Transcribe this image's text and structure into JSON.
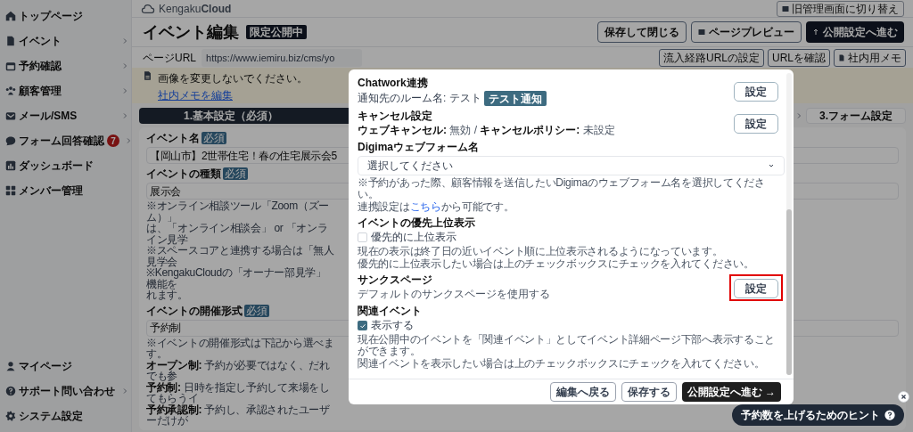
{
  "header": {
    "logo_text": "Kengaku",
    "logo_bold": "Cloud",
    "switch_button": "旧管理画面に切り替え"
  },
  "sidebar": {
    "items": [
      {
        "label": "トップページ",
        "expandable": false
      },
      {
        "label": "イベント",
        "expandable": true
      },
      {
        "label": "予約確認",
        "expandable": true
      },
      {
        "label": "顧客管理",
        "expandable": true
      },
      {
        "label": "メール/SMS",
        "expandable": true
      },
      {
        "label": "フォーム回答確認",
        "expandable": true,
        "badge": "7"
      },
      {
        "label": "ダッシュボード",
        "expandable": false
      },
      {
        "label": "メンバー管理",
        "expandable": false
      }
    ],
    "bottom_items": [
      {
        "label": "マイページ",
        "expandable": false
      },
      {
        "label": "サポート問い合わせ",
        "expandable": true
      },
      {
        "label": "システム設定",
        "expandable": false
      }
    ]
  },
  "page": {
    "title": "イベント編集",
    "status_badge": "限定公開中",
    "actions": [
      {
        "label": "保存して閉じる",
        "kind": "outline"
      },
      {
        "label": "ページプレビュー",
        "kind": "preview"
      },
      {
        "label": "公開設定へ進む",
        "kind": "primary"
      }
    ],
    "url": {
      "label": "ページURL",
      "value": "https://www.iemiru.biz/cms/yo"
    },
    "url_actions": [
      {
        "label": "流入経路URLの設定",
        "kind": "plain"
      },
      {
        "label": "URLを確認",
        "kind": "plain"
      },
      {
        "label": "社内用メモ",
        "kind": "memo"
      }
    ],
    "memo": {
      "text": "画像を変更しないでください。",
      "link": "社内メモを編集"
    },
    "steps": [
      {
        "label": "1.基本設定（必須）",
        "selected": true
      },
      {
        "label": "3.フォーム設定",
        "selected": false
      }
    ],
    "form": [
      {
        "label": "イベント名",
        "required": "必須",
        "value": "【岡山市】2世帯住宅！春の住宅展示会5"
      },
      {
        "label": "イベントの種類",
        "required": "必須",
        "value": "展示会",
        "notes": [
          "※オンライン相談ツール「Zoom（ズーム）」",
          "は、「オンライン相談会」 or 「オンライン見学",
          "※スペースコアと連携する場合は「無人見学会",
          "※KengakuCloudの「オーナー部見学」機能を",
          "れます。"
        ]
      },
      {
        "label": "イベントの開催形式",
        "required": "必須",
        "value": "予約制",
        "notes": [
          "※イベントの開催形式は下記から選べます。",
          "**オープン制:** 予約が必要ではなく、だれでも参",
          "**予約制:** 日時を指定し予約して来場をしてもらうイ",
          "**予約承認制:** 予約し、承認されたユーザーだけが"
        ]
      }
    ]
  },
  "modal": {
    "sections": [
      {
        "kind": "setting",
        "title": "Chatwork連携",
        "text": "通知先のルーム名: テスト",
        "tag": "テスト通知",
        "button": "設定",
        "highlighted": false
      },
      {
        "kind": "setting",
        "title": "キャンセル設定",
        "text": "**ウェブキャンセル:** 無効 / **キャンセルポリシー:** 未設定",
        "button": "設定",
        "highlighted": false
      },
      {
        "kind": "select",
        "title": "Digimaウェブフォーム名",
        "value": "選択してください",
        "notes": [
          "※予約があった際、顧客情報を送信したいDigimaのウェブフォーム名を選択してください。"
        ],
        "link_note": {
          "before": "連携設定は",
          "link": "こちら",
          "after": "から可能です。"
        }
      },
      {
        "kind": "checkbox",
        "title": "イベントの優先上位表示",
        "label": "優先的に上位表示",
        "checked": false,
        "notes": [
          "現在の表示は終了日の近いイベント順に上位表示されるようになっています。",
          "優先的に上位表示したい場合は上のチェックボックスにチェックを入れてください。"
        ]
      },
      {
        "kind": "setting",
        "title": "サンクスページ",
        "text": "デフォルトのサンクスページを使用する",
        "button": "設定",
        "highlighted": true
      },
      {
        "kind": "checkbox",
        "title": "関連イベント",
        "label": "表示する",
        "checked": true,
        "notes": [
          "現在公開中のイベントを「関連イベント」としてイベント詳細ページ下部へ表示することができます。",
          "関連イベントを表示したい場合は上のチェックボックスにチェックを入れてください。"
        ]
      }
    ],
    "footer": [
      {
        "label": "編集へ戻る",
        "kind": "outline"
      },
      {
        "label": "保存する",
        "kind": "outline"
      },
      {
        "label": "公開設定へ進む →",
        "kind": "primary"
      }
    ]
  },
  "hint": {
    "label": "予約数を上げるためのヒント"
  }
}
